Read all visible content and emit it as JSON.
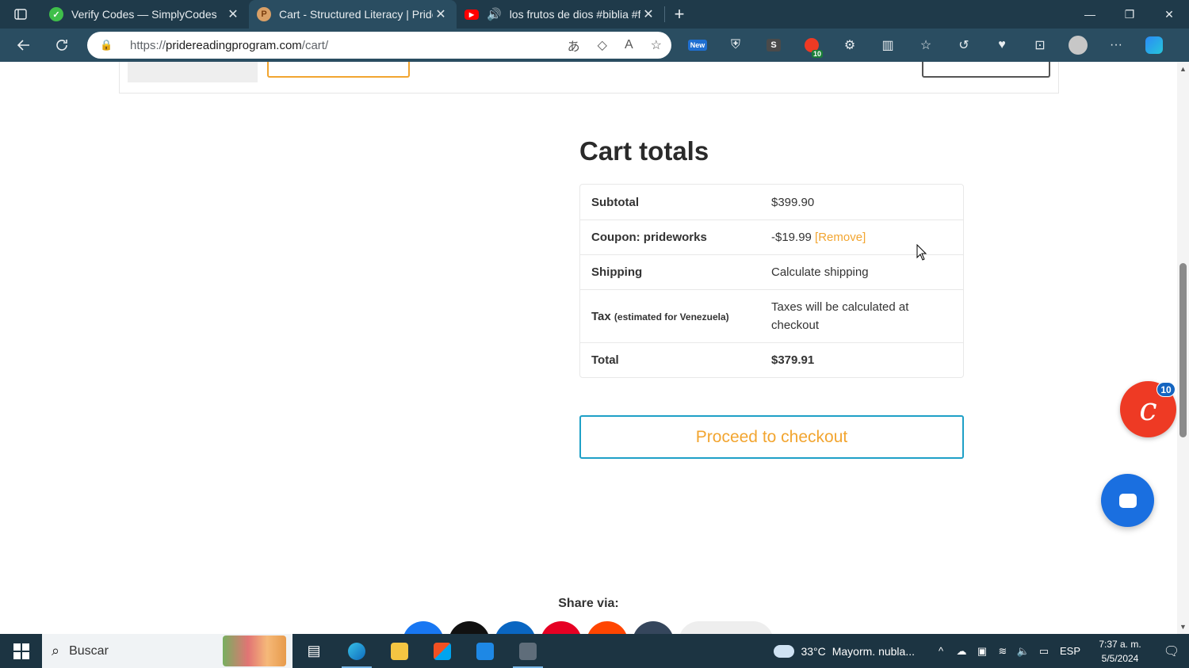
{
  "browser": {
    "tabs": [
      {
        "title": "Verify Codes — SimplyCodes",
        "favicon": "simplycodes-icon",
        "active": false
      },
      {
        "title": "Cart - Structured Literacy | Pride",
        "favicon": "pride-icon",
        "active": true
      },
      {
        "title": "los frutos de dios #biblia #f",
        "favicon": "youtube-icon",
        "active": false
      }
    ],
    "url_prefix": "https://",
    "url_domain": "pridereadingprogram.com",
    "url_path": "/cart/",
    "ext_badge_count": "10",
    "ext_new_label": "New",
    "ext_s_label": "S"
  },
  "page": {
    "heading": "Cart totals",
    "totals": {
      "subtotal_label": "Subtotal",
      "subtotal_value": "$399.90",
      "coupon_label": "Coupon: prideworks",
      "coupon_value": "-$19.99",
      "coupon_remove": "[Remove]",
      "shipping_label": "Shipping",
      "shipping_value": "Calculate shipping",
      "tax_label": "Tax",
      "tax_note": "(estimated for Venezuela)",
      "tax_value": "Taxes will be calculated at checkout",
      "total_label": "Total",
      "total_value": "$379.91"
    },
    "checkout_button": "Proceed to checkout",
    "share_label": "Share via:",
    "chat_badge": "10"
  },
  "colors": {
    "accent_orange": "#f2a530",
    "checkout_border": "#1fa0c7",
    "chat_red": "#ee3a24",
    "messenger_blue": "#1a6fe0"
  },
  "taskbar": {
    "search_placeholder": "Buscar",
    "weather_temp": "33°C",
    "weather_text": "Mayorm. nubla...",
    "language": "ESP",
    "time": "7:37 a. m.",
    "date": "5/5/2024"
  }
}
